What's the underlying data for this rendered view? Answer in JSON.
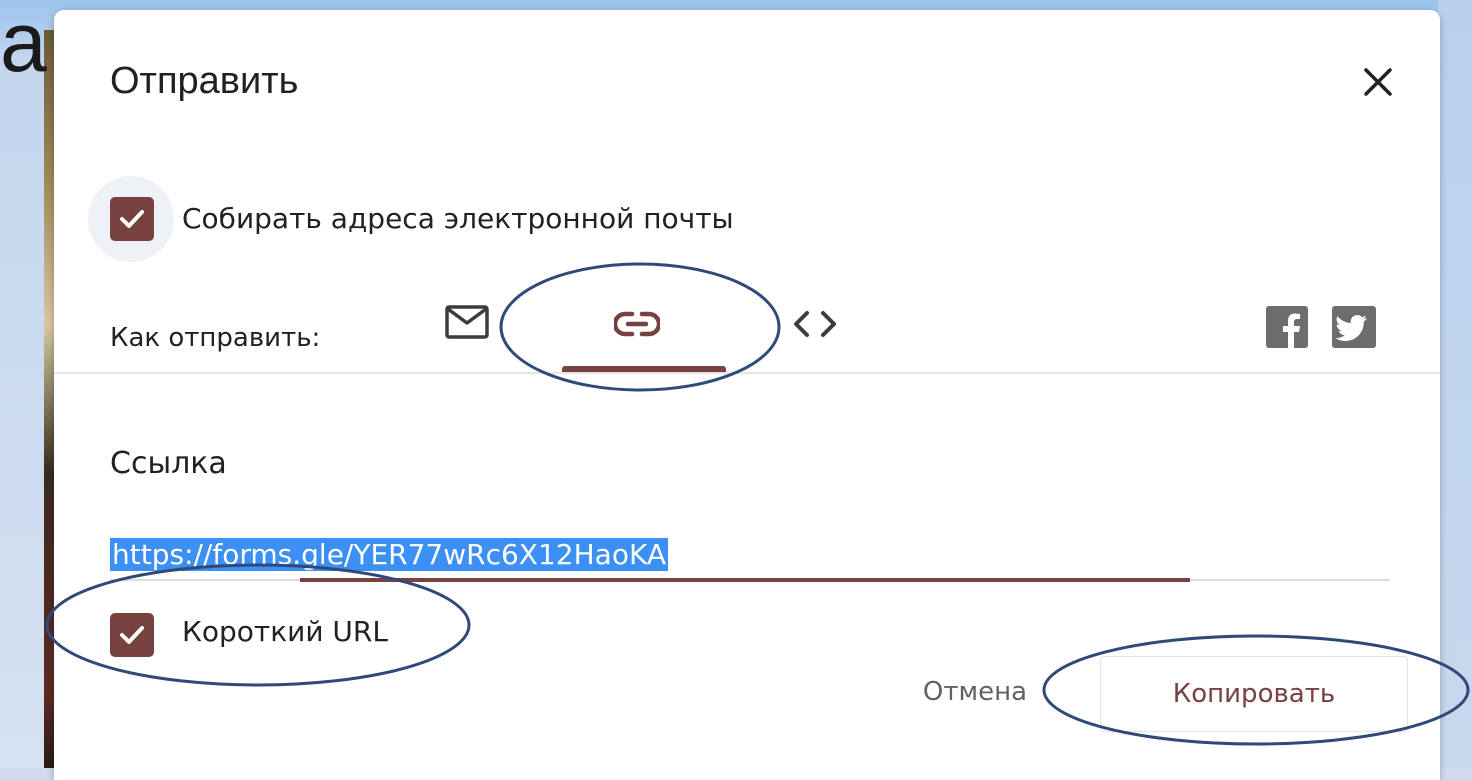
{
  "slide": {
    "partial_letter": "а"
  },
  "dialog": {
    "title": "Отправить",
    "close_icon": "close-icon",
    "collect_emails": {
      "label": "Собирать адреса электронной почты",
      "checked": true
    },
    "send_via": {
      "label": "Как отправить:",
      "options": [
        {
          "icon": "mail-icon",
          "selected": false
        },
        {
          "icon": "link-icon",
          "selected": true
        },
        {
          "icon": "embed-code-icon",
          "selected": false
        }
      ],
      "social": [
        {
          "icon": "facebook-icon"
        },
        {
          "icon": "twitter-icon"
        }
      ]
    },
    "link_section": {
      "heading": "Ссылка",
      "url": "https://forms.gle/YER77wRc6X12HaoKA",
      "short_url": {
        "label": "Короткий URL",
        "checked": true
      }
    },
    "actions": {
      "cancel": "Отмена",
      "copy": "Копировать"
    }
  },
  "colors": {
    "accent": "#774140",
    "selection": "#3c8ff5",
    "annotation": "#2f4a78"
  }
}
